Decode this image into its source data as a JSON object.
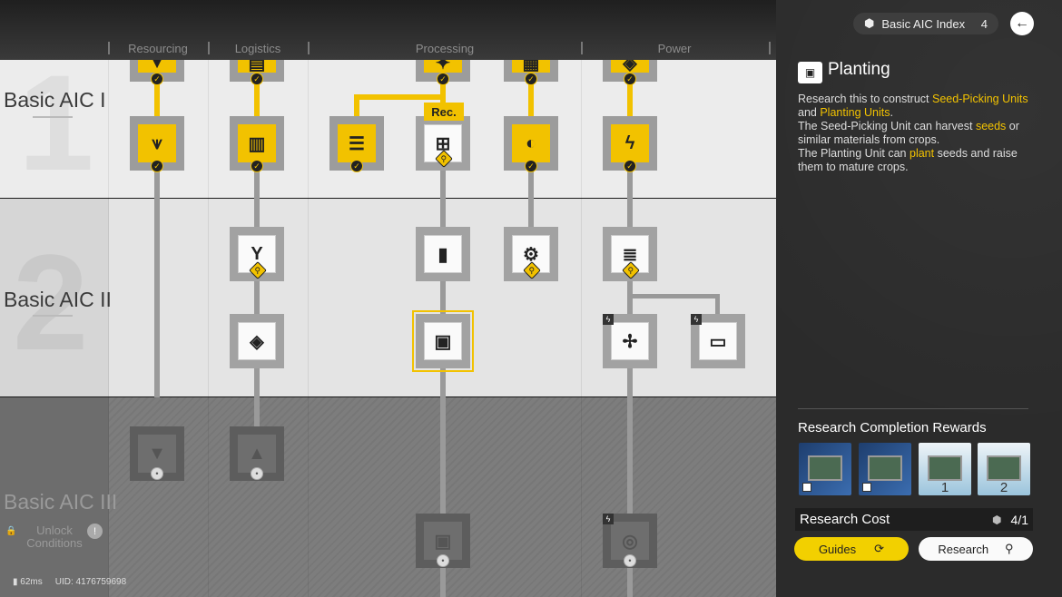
{
  "header": {
    "columns": [
      "Resourcing",
      "Logistics",
      "Processing",
      "Power"
    ]
  },
  "tiers": [
    {
      "label": "Basic AIC I",
      "bignum": "1"
    },
    {
      "label": "Basic AIC II",
      "bignum": "2"
    },
    {
      "label": "Basic AIC III",
      "bignum": ""
    }
  ],
  "tier3": {
    "unlock_text": "Unlock Conditions",
    "info": "!"
  },
  "tree": {
    "recommended_badge": "Rec."
  },
  "footer": {
    "ping": "62ms",
    "uid": "UID: 4176759698"
  },
  "panel": {
    "index_label": "Basic AIC Index",
    "index_value": "4",
    "title": "Planting",
    "desc": {
      "p1": "Research this to construct ",
      "h1": "Seed-Picking Units",
      "p2": " and ",
      "h2": "Planting Units",
      "p3": ".",
      "p4": "The Seed-Picking Unit can harvest ",
      "h3": "seeds",
      "p5": " or similar materials from crops.",
      "p6": "The Planting Unit can ",
      "h4": "plant",
      "p7": " seeds and raise them to mature crops."
    },
    "rewards_title": "Research Completion Rewards",
    "rewards": [
      "",
      "",
      "1",
      "2"
    ],
    "cost_label": "Research Cost",
    "cost_value": "4/1",
    "guides_label": "Guides",
    "research_label": "Research"
  },
  "colors": {
    "accent": "#f2c200",
    "panel_bg": "#2b2b2b"
  }
}
